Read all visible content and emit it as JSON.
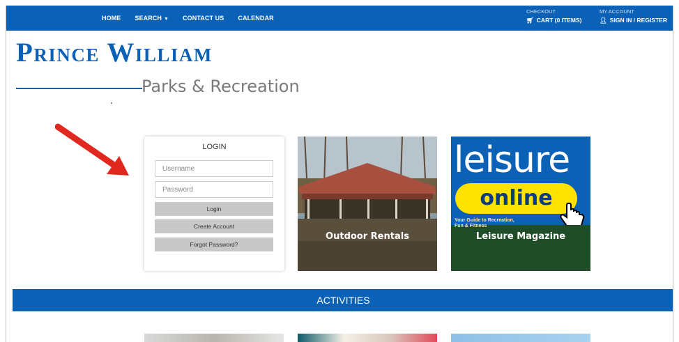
{
  "nav": {
    "links": [
      "HOME",
      "SEARCH",
      "CONTACT US",
      "CALENDAR"
    ],
    "checkout_label": "CHECKOUT",
    "cart_label": "CART (0 ITEMS)",
    "account_label": "MY ACCOUNT",
    "signin_label": "SIGN IN / REGISTER"
  },
  "logo": {
    "title": "Prince William",
    "subtitle": "Parks & Recreation"
  },
  "login": {
    "title": "LOGIN",
    "username_placeholder": "Username",
    "password_placeholder": "Password",
    "login_button": "Login",
    "create_button": "Create Account",
    "forgot_button": "Forgot Password?"
  },
  "tiles": {
    "rentals_label": "Outdoor Rentals",
    "leisure_label": "Leisure Magazine",
    "leisure_word": "leisure",
    "leisure_online": "online",
    "leisure_tag_line1": "Your Guide to Recreation,",
    "leisure_tag_line2": "Fun & Fitness"
  },
  "sections": {
    "activities": "ACTIVITIES"
  },
  "colors": {
    "brand_blue": "#0b61b6",
    "arrow_red": "#e0281e",
    "button_gray": "#c8c8c8"
  },
  "icons": [
    "cart-icon",
    "user-icon",
    "caret-down-icon",
    "hand-pointer-icon",
    "red-arrow-icon"
  ]
}
